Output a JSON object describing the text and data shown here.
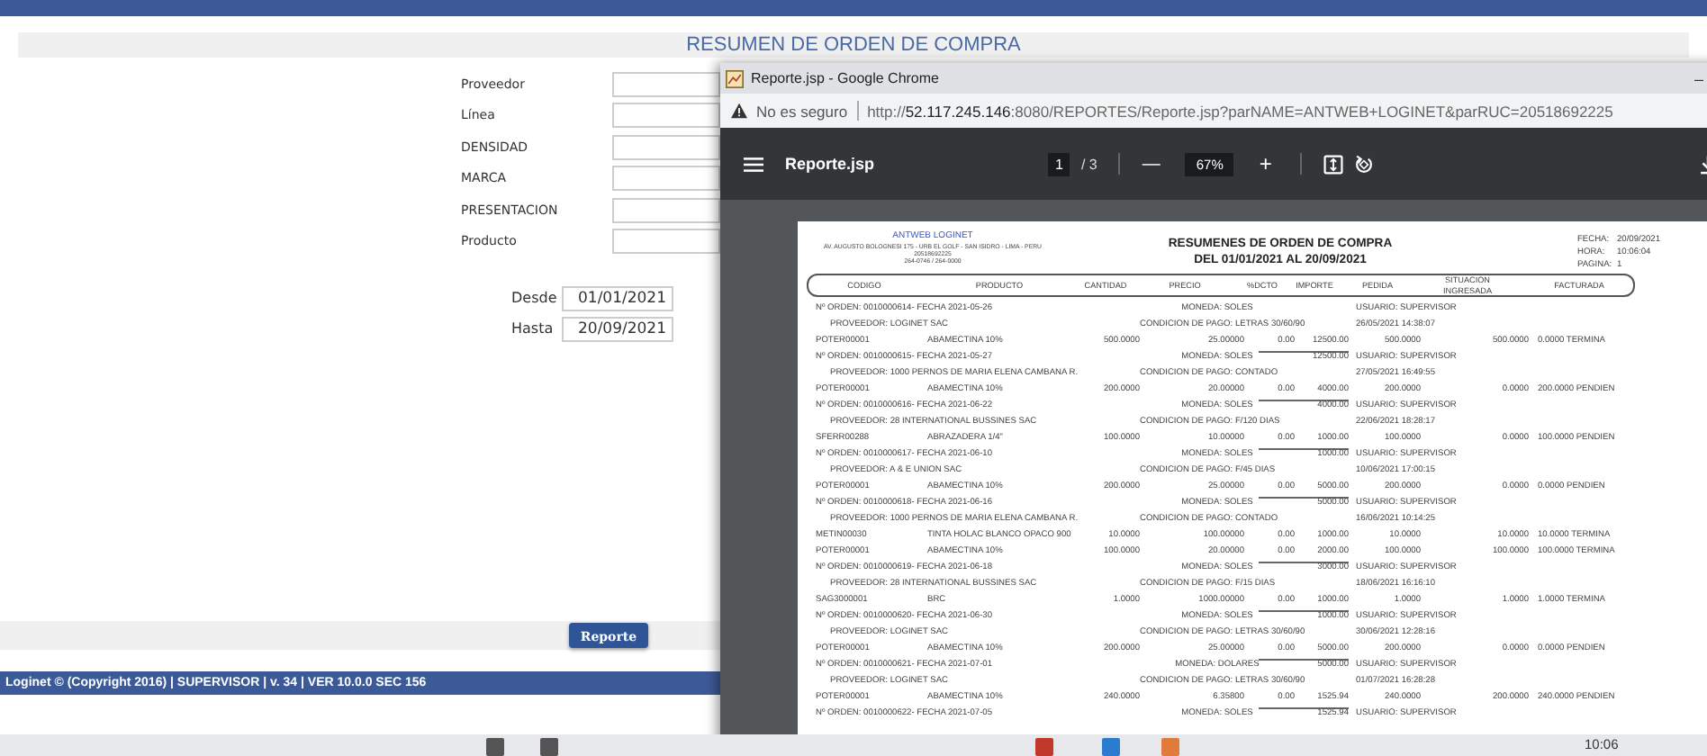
{
  "app": {
    "title": "RESUMEN DE ORDEN DE COMPRA",
    "fields": [
      {
        "label": "Proveedor"
      },
      {
        "label": "Línea"
      },
      {
        "label": "DENSIDAD"
      },
      {
        "label": "MARCA"
      },
      {
        "label": "PRESENTACION"
      },
      {
        "label": "Producto"
      }
    ],
    "date_fields": [
      {
        "label": "Desde",
        "value": "01/01/2021"
      },
      {
        "label": "Hasta",
        "value": "20/09/2021"
      }
    ],
    "button": "Reporte",
    "footer": "Loginet © (Copyright 2016) | SUPERVISOR | v. 34 | VER 10.0.0 SEC 156"
  },
  "browser": {
    "title": "Reporte.jsp - Google Chrome",
    "minimize": "–",
    "security": "No es seguro",
    "url": "http://**52.117.245.146**:8080/REPORTES/Reporte.jsp?parNAME=ANTWEB+LOGINET&parRUC=20518692225"
  },
  "pdf_toolbar": {
    "filename": "Reporte.jsp",
    "page": "1",
    "page_total": "/ 3",
    "minus": "—",
    "zoom": "67%",
    "plus": "+"
  },
  "report": {
    "company": "ANTWEB LOGINET",
    "address_lines": [
      "AV. AUGUSTO BOLOGNESI 175 - URB EL GOLF - SAN ISIDRO - LIMA - PERU",
      "20518692225",
      "264-0746 / 264-0000"
    ],
    "title": "RESUMENES DE ORDEN DE COMPRA",
    "subtitle": "DEL 01/01/2021 AL 20/09/2021",
    "meta": [
      {
        "label": "FECHA:",
        "value": "20/09/2021"
      },
      {
        "label": "HORA:",
        "value": "10:06:04"
      },
      {
        "label": "PAGINA:",
        "value": "1"
      }
    ],
    "columns": [
      {
        "label": "CODIGO"
      },
      {
        "label": "PRODUCTO"
      },
      {
        "label": "CANTIDAD"
      },
      {
        "label": "PRECIO"
      },
      {
        "label": "%DCTO"
      },
      {
        "label": "IMPORTE"
      },
      {
        "label": "PEDIDA"
      },
      {
        "label": "INGRESADA",
        "group": "SITUACION"
      },
      {
        "label": "FACTURADA"
      }
    ],
    "lines": [
      {
        "kind": "order",
        "text": "Nº ORDEN: 0010000614-  FECHA 2021-05-26",
        "moneda": "MONEDA: SOLES",
        "usuario": "USUARIO: SUPERVISOR"
      },
      {
        "kind": "provider",
        "text": "PROVEEDOR: LOGINET SAC",
        "condicion": "CONDICION DE PAGO: LETRAS 30/60/90",
        "timestamp": "26/05/2021    14:38:07"
      },
      {
        "kind": "item",
        "cells": [
          "POTER00001",
          "ABAMECTINA 10%",
          "500.0000",
          "25.00000",
          "0.00",
          "12500.00",
          "500.0000",
          "500.0000",
          "0.0000 TERMINA"
        ]
      },
      {
        "kind": "order",
        "text": "Nº ORDEN: 0010000615-  FECHA 2021-05-27",
        "moneda": "MONEDA: SOLES",
        "total": "12500.00",
        "usuario": "USUARIO: SUPERVISOR"
      },
      {
        "kind": "provider",
        "text": "PROVEEDOR: 1000 PERNOS DE MARIA ELENA CAMBANA R.",
        "condicion": "CONDICION DE PAGO: CONTADO",
        "timestamp": "27/05/2021    16:49:55"
      },
      {
        "kind": "item",
        "cells": [
          "POTER00001",
          "ABAMECTINA 10%",
          "200.0000",
          "20.00000",
          "0.00",
          "4000.00",
          "200.0000",
          "0.0000",
          "200.0000 PENDIEN"
        ]
      },
      {
        "kind": "order",
        "text": "Nº ORDEN: 0010000616-  FECHA 2021-06-22",
        "moneda": "MONEDA: SOLES",
        "total": "4000.00",
        "usuario": "USUARIO: SUPERVISOR"
      },
      {
        "kind": "provider",
        "text": "PROVEEDOR: 28 INTERNATIONAL BUSSINES SAC",
        "condicion": "CONDICION DE PAGO: F/120 DIAS",
        "timestamp": "22/06/2021    18:28:17"
      },
      {
        "kind": "item",
        "cells": [
          "SFERR00288",
          "ABRAZADERA  1/4\"",
          "100.0000",
          "10.00000",
          "0.00",
          "1000.00",
          "100.0000",
          "0.0000",
          "100.0000 PENDIEN"
        ]
      },
      {
        "kind": "order",
        "text": "Nº ORDEN: 0010000617-  FECHA 2021-06-10",
        "moneda": "MONEDA: SOLES",
        "total": "1000.00",
        "usuario": "USUARIO: SUPERVISOR"
      },
      {
        "kind": "provider",
        "text": "PROVEEDOR: A & E UNION SAC",
        "condicion": "CONDICION DE PAGO: F/45 DIAS",
        "timestamp": "10/06/2021    17:00:15"
      },
      {
        "kind": "item",
        "cells": [
          "POTER00001",
          "ABAMECTINA 10%",
          "200.0000",
          "25.00000",
          "0.00",
          "5000.00",
          "200.0000",
          "0.0000",
          "0.0000 PENDIEN"
        ]
      },
      {
        "kind": "order",
        "text": "Nº ORDEN: 0010000618-  FECHA 2021-06-16",
        "moneda": "MONEDA: SOLES",
        "total": "5000.00",
        "usuario": "USUARIO: SUPERVISOR"
      },
      {
        "kind": "provider",
        "text": "PROVEEDOR: 1000 PERNOS DE MARIA ELENA CAMBANA R.",
        "condicion": "CONDICION DE PAGO: CONTADO",
        "timestamp": "16/06/2021    10:14:25"
      },
      {
        "kind": "item",
        "cells": [
          "METIN00030",
          "TINTA HOLAC BLANCO OPACO 900",
          "10.0000",
          "100.00000",
          "0.00",
          "1000.00",
          "10.0000",
          "10.0000",
          "10.0000 TERMINA"
        ]
      },
      {
        "kind": "item",
        "cells": [
          "POTER00001",
          "ABAMECTINA 10%",
          "100.0000",
          "20.00000",
          "0.00",
          "2000.00",
          "100.0000",
          "100.0000",
          "100.0000 TERMINA"
        ]
      },
      {
        "kind": "order",
        "text": "Nº ORDEN: 0010000619-  FECHA 2021-06-18",
        "moneda": "MONEDA: SOLES",
        "total": "3000.00",
        "usuario": "USUARIO: SUPERVISOR"
      },
      {
        "kind": "provider",
        "text": "PROVEEDOR: 28 INTERNATIONAL BUSSINES SAC",
        "condicion": "CONDICION DE PAGO: F/15 DIAS",
        "timestamp": "18/06/2021    16:16:10"
      },
      {
        "kind": "item",
        "cells": [
          "SAG3000001",
          "BRC",
          "1.0000",
          "1000.00000",
          "0.00",
          "1000.00",
          "1.0000",
          "1.0000",
          "1.0000 TERMINA"
        ]
      },
      {
        "kind": "order",
        "text": "Nº ORDEN: 0010000620-  FECHA 2021-06-30",
        "moneda": "MONEDA: SOLES",
        "total": "1000.00",
        "usuario": "USUARIO: SUPERVISOR"
      },
      {
        "kind": "provider",
        "text": "PROVEEDOR: LOGINET SAC",
        "condicion": "CONDICION DE PAGO: LETRAS 30/60/90",
        "timestamp": "30/06/2021    12:28:16"
      },
      {
        "kind": "item",
        "cells": [
          "POTER00001",
          "ABAMECTINA 10%",
          "200.0000",
          "25.00000",
          "0.00",
          "5000.00",
          "200.0000",
          "0.0000",
          "0.0000 PENDIEN"
        ]
      },
      {
        "kind": "order",
        "text": "Nº ORDEN: 0010000621-  FECHA 2021-07-01",
        "moneda": "MONEDA: DOLARES",
        "total": "5000.00",
        "usuario": "USUARIO: SUPERVISOR"
      },
      {
        "kind": "provider",
        "text": "PROVEEDOR: LOGINET SAC",
        "condicion": "CONDICION DE PAGO: LETRAS 30/60/90",
        "timestamp": "01/07/2021    16:28:28"
      },
      {
        "kind": "item",
        "cells": [
          "POTER00001",
          "ABAMECTINA 10%",
          "240.0000",
          "6.35800",
          "0.00",
          "1525.94",
          "240.0000",
          "200.0000",
          "240.0000 PENDIEN"
        ]
      },
      {
        "kind": "order",
        "text": "Nº ORDEN: 0010000622-  FECHA 2021-07-05",
        "moneda": "MONEDA: SOLES",
        "total": "1525.94",
        "usuario": "USUARIO: SUPERVISOR"
      }
    ]
  },
  "taskbar": {
    "clock": "10:06"
  }
}
